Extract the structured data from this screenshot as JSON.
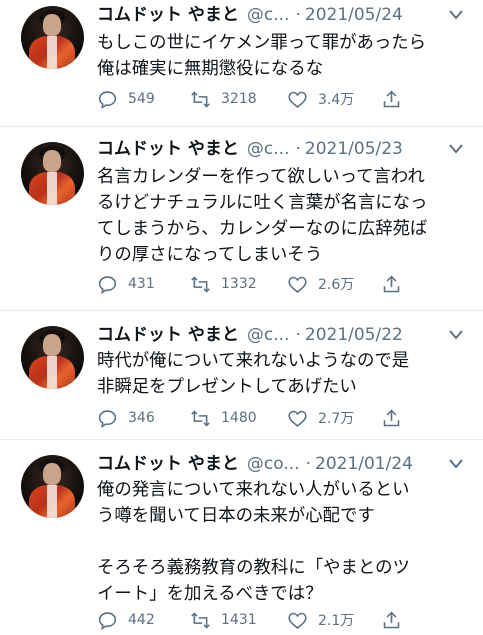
{
  "tweets": [
    {
      "name": "コムドット やまと",
      "handle": "@c...",
      "date": "2021/05/24",
      "text": "もしこの世にイケメン罪って罪があったら\n俺は確実に無期懲役になるな",
      "replies": "549",
      "retweets": "3218",
      "likes": "3.4万"
    },
    {
      "name": "コムドット やまと",
      "handle": "@c...",
      "date": "2021/05/23",
      "text": "名言カレンダーを作って欲しいって言われ\nるけどナチュラルに吐く言葉が名言になっ\nてしまうから、カレンダーなのに広辞苑ば\nりの厚さになってしまいそう",
      "replies": "431",
      "retweets": "1332",
      "likes": "2.6万"
    },
    {
      "name": "コムドット やまと",
      "handle": "@c...",
      "date": "2021/05/22",
      "text": "時代が俺について来れないようなので是\n非瞬足をプレゼントしてあげたい",
      "replies": "346",
      "retweets": "1480",
      "likes": "2.7万"
    },
    {
      "name": "コムドット やまと",
      "handle": "@co...",
      "date": "2021/01/24",
      "text": "俺の発言について来れない人がいるとい\nう噂を聞いて日本の未来が心配です\n\nそろそろ義務教育の教科に「やまとのツ\nイート」を加えるべきでは？",
      "replies": "442",
      "retweets": "1431",
      "likes": "2.1万"
    }
  ],
  "separator": "·"
}
